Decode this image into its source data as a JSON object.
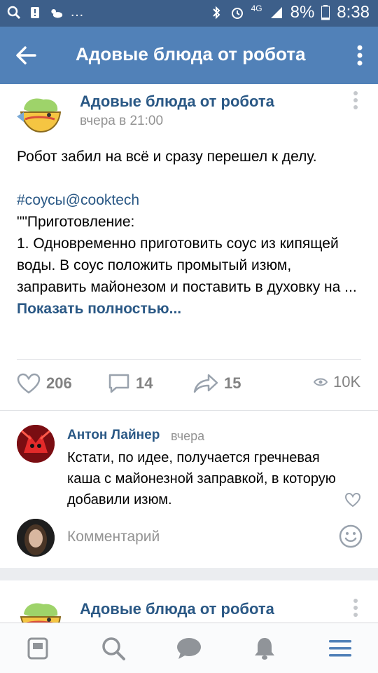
{
  "status_bar": {
    "battery": "8%",
    "time": "8:38",
    "network": "4G"
  },
  "app_bar": {
    "title": "Адовые блюда от робота"
  },
  "post": {
    "author": "Адовые блюда от робота",
    "time": "вчера в 21:00",
    "line1": "Робот забил на всё и сразу перешел к делу.",
    "hashtag": "#соусы@cooktech",
    "line2": "\"\"Приготовление:",
    "line3": "1. Одновременно приготовить соус из кипящей воды. В соус положить промытый изюм, заправить майонезом и поставить в духовку на ...",
    "show_more": "Показать полностью...",
    "likes": "206",
    "comments": "14",
    "shares": "15",
    "views": "10K"
  },
  "comment": {
    "author": "Антон Лайнер",
    "time": "вчера",
    "text": "Кстати, по идее, получается гречневая каша с майонезной заправкой, в которую добавили изюм."
  },
  "comment_input": {
    "placeholder": "Комментарий"
  },
  "next_post": {
    "author": "Адовые блюда от робота"
  },
  "colors": {
    "header": "#5181b8",
    "status_bar": "#3d5f8a",
    "link": "#2a5885",
    "muted": "#939393"
  }
}
